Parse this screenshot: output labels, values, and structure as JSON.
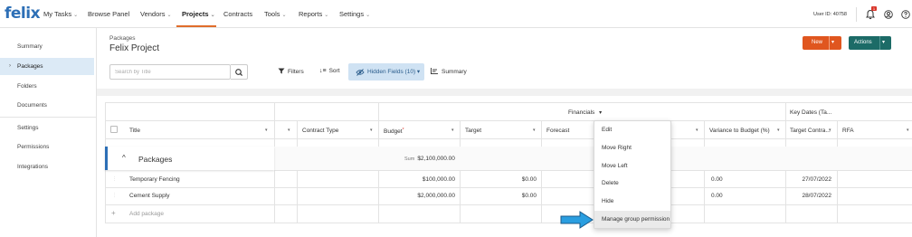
{
  "app": {
    "logo": "felix"
  },
  "nav": {
    "items": [
      {
        "label": "My Tasks",
        "chevron": "⌄"
      },
      {
        "label": "Browse Panel",
        "chevron": ""
      },
      {
        "label": "Vendors",
        "chevron": "⌄"
      },
      {
        "label": "Projects",
        "chevron": "⌄",
        "active": true
      },
      {
        "label": "Contracts",
        "chevron": ""
      },
      {
        "label": "Tools",
        "chevron": "⌄"
      },
      {
        "label": "Reports",
        "chevron": "⌄"
      },
      {
        "label": "Settings",
        "chevron": "⌄"
      }
    ],
    "user_id": "User ID: 40758",
    "notification_count": "1",
    "icons": [
      "bell-icon",
      "user-circle-icon",
      "help-circle-icon"
    ]
  },
  "sidebar": {
    "items": [
      {
        "label": "Summary"
      },
      {
        "label": "Packages",
        "active": true
      },
      {
        "label": "Folders"
      },
      {
        "label": "Documents"
      },
      {
        "label": "Settings"
      },
      {
        "label": "Permissions"
      },
      {
        "label": "Integrations"
      }
    ]
  },
  "header": {
    "breadcrumb": "Packages",
    "title": "Felix Project",
    "new_label": "New",
    "actions_label": "Actions"
  },
  "toolbar": {
    "search_placeholder": "Search by Title",
    "filters_label": "Filters",
    "sort_label": "Sort",
    "hidden_fields_label": "Hidden Fields (10)",
    "summary_label": "Summary"
  },
  "grid": {
    "group_headers": {
      "financials": "Financials",
      "key_dates": "Key Dates (Ta..."
    },
    "columns": {
      "title": "Title",
      "contract_type": "Contract Type",
      "budget": "Budget",
      "target": "Target",
      "forecast": "Forecast",
      "variance": "Variance to Budget (%)",
      "target_contract": "Target Contra...",
      "rfa": "RFA"
    },
    "group": {
      "label": "Packages",
      "sum_label": "Sum",
      "sum_value": "$2,100,000.00"
    },
    "rows": [
      {
        "title": "Temporary Fencing",
        "budget": "$100,000.00",
        "target": "$0.00",
        "variance": "0.00",
        "target_contract": "27/07/2022"
      },
      {
        "title": "Cement Supply",
        "budget": "$2,000,000.00",
        "target": "$0.00",
        "variance": "0.00",
        "target_contract": "28/07/2022"
      }
    ],
    "add_row_label": "Add package"
  },
  "context_menu": {
    "items": [
      {
        "label": "Edit"
      },
      {
        "label": "Move Right"
      },
      {
        "label": "Move Left"
      },
      {
        "label": "Delete"
      },
      {
        "label": "Hide"
      },
      {
        "label": "Manage group permission"
      }
    ]
  },
  "colors": {
    "brand": "#2d6fb6",
    "new_button": "#e0561f",
    "actions_button": "#1c6b67",
    "nav_active_underline": "#e06d2b",
    "pointer_arrow": "#2a9ee0"
  }
}
